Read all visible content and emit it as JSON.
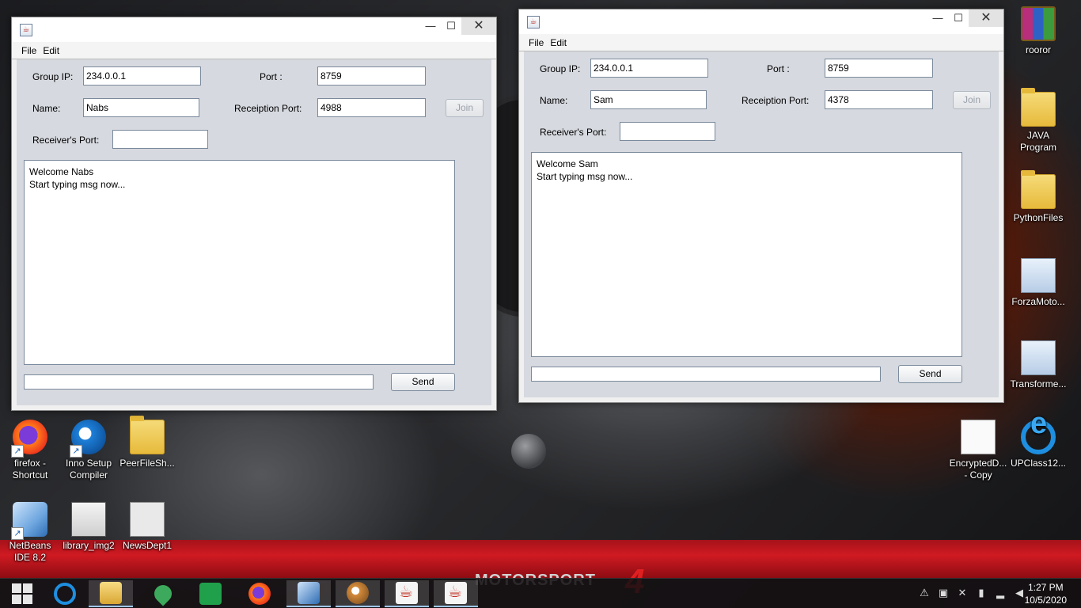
{
  "desktop": {
    "icons": [
      {
        "id": "roorer",
        "label": "rooror"
      },
      {
        "id": "java-program",
        "label": "JAVA Program"
      },
      {
        "id": "python-files",
        "label": "PythonFiles"
      },
      {
        "id": "forza",
        "label": "ForzaMoto..."
      },
      {
        "id": "transforme",
        "label": "Transforme..."
      },
      {
        "id": "firefox",
        "label": "firefox - Shortcut"
      },
      {
        "id": "inno",
        "label": "Inno Setup Compiler"
      },
      {
        "id": "peerfile",
        "label": "PeerFileSh..."
      },
      {
        "id": "netbeans",
        "label": "NetBeans IDE 8.2"
      },
      {
        "id": "library",
        "label": "library_img2"
      },
      {
        "id": "newsdept",
        "label": "NewsDept1"
      },
      {
        "id": "encrypted",
        "label": "EncryptedD... - Copy"
      },
      {
        "id": "upclass",
        "label": "UPClass12..."
      }
    ],
    "wallpaper_brand": "MOTORSPORT",
    "wallpaper_number": "4"
  },
  "windows": [
    {
      "menu": [
        "File",
        "Edit"
      ],
      "labels": {
        "group_ip": "Group IP:",
        "port": "Port :",
        "name": "Name:",
        "reception_port": "Receiption Port:",
        "receivers_port": "Receiver's Port:"
      },
      "values": {
        "group_ip": "234.0.0.1",
        "port": "8759",
        "name": "Nabs",
        "reception_port": "4988",
        "receivers_port": "",
        "message_input": ""
      },
      "join_label": "Join",
      "send_label": "Send",
      "chat_lines": [
        "Welcome Nabs",
        "Start typing msg now..."
      ]
    },
    {
      "menu": [
        "File",
        "Edit"
      ],
      "labels": {
        "group_ip": "Group IP:",
        "port": "Port :",
        "name": "Name:",
        "reception_port": "Receiption Port:",
        "receivers_port": "Receiver's Port:"
      },
      "values": {
        "group_ip": "234.0.0.1",
        "port": "8759",
        "name": "Sam",
        "reception_port": "4378",
        "receivers_port": "",
        "message_input": ""
      },
      "join_label": "Join",
      "send_label": "Send",
      "chat_lines": [
        "Welcome Sam",
        "Start typing msg now..."
      ]
    }
  ],
  "taskbar": {
    "items": [
      "start",
      "internet-explorer",
      "file-explorer",
      "maps",
      "store",
      "firefox",
      "netbeans",
      "paint",
      "java-1",
      "java-2"
    ],
    "time": "1:27 PM",
    "date": "10/5/2020"
  }
}
